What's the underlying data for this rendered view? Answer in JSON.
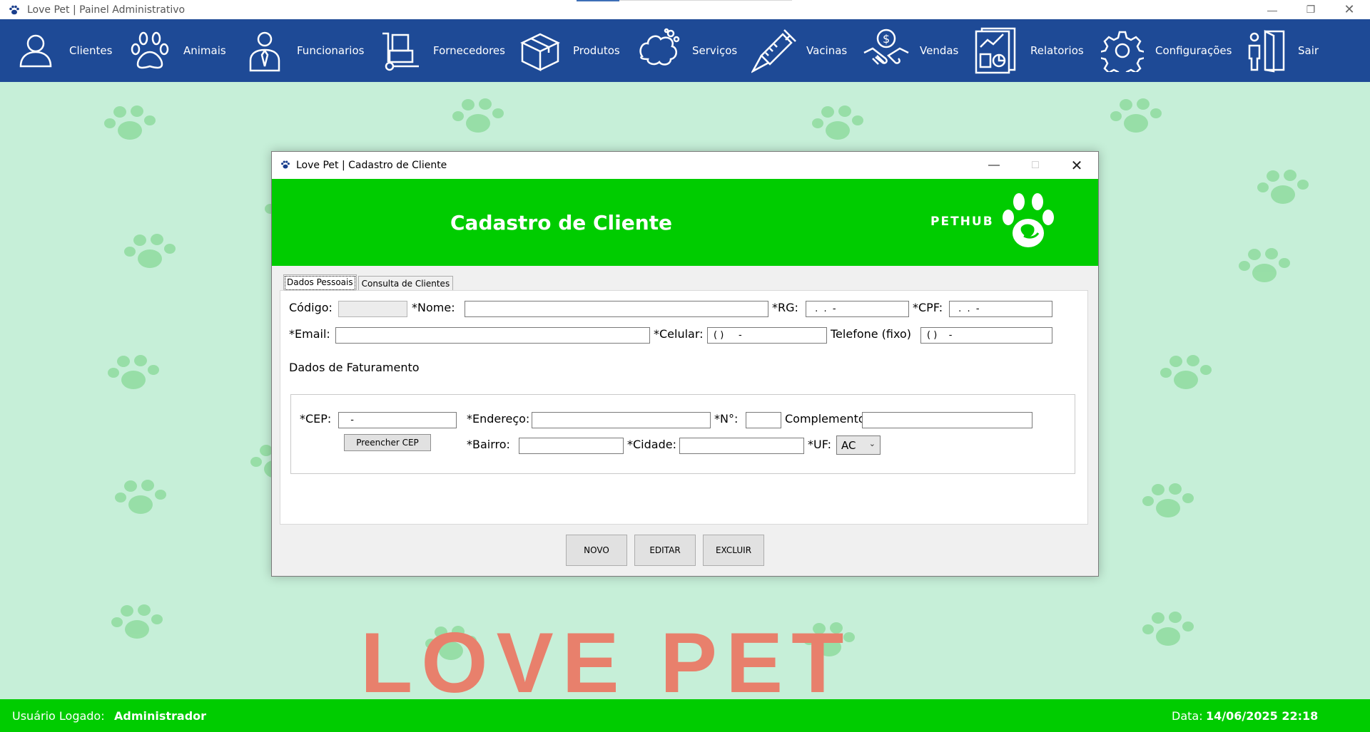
{
  "window": {
    "title": "Love Pet | Painel Administrativo"
  },
  "nav": {
    "items": [
      {
        "label": "Clientes",
        "icon": "user-icon"
      },
      {
        "label": "Animais",
        "icon": "paw-icon"
      },
      {
        "label": "Funcionarios",
        "icon": "employee-icon"
      },
      {
        "label": "Fornecedores",
        "icon": "hand-truck-icon"
      },
      {
        "label": "Produtos",
        "icon": "box-icon"
      },
      {
        "label": "Serviços",
        "icon": "bath-icon"
      },
      {
        "label": "Vacinas",
        "icon": "syringe-icon"
      },
      {
        "label": "Vendas",
        "icon": "handshake-icon"
      },
      {
        "label": "Relatorios",
        "icon": "report-icon"
      },
      {
        "label": "Configurações",
        "icon": "gear-icon"
      },
      {
        "label": "Sair",
        "icon": "exit-door-icon"
      }
    ]
  },
  "background": {
    "text": "LOVE PET"
  },
  "dialog": {
    "title": "Love Pet | Cadastro de Cliente",
    "header_title": "Cadastro de Cliente",
    "brand": "PETHUB",
    "tabs": [
      "Dados Pessoais",
      "Consulta de Clientes"
    ],
    "fields": {
      "codigo_label": "Código:",
      "nome_label": "*Nome:",
      "rg_label": "*RG:",
      "rg_mask": " .  .  -",
      "cpf_label": "*CPF:",
      "cpf_mask": " .  .  -",
      "email_label": "*Email:",
      "celular_label": "*Celular:",
      "celular_mask": "( )     -",
      "telefone_label": "Telefone (fixo)",
      "telefone_mask": "( )    -"
    },
    "faturamento": {
      "section_title": "Dados de Faturamento",
      "cep_label": "*CEP:",
      "cep_mask": "  -",
      "endereco_label": "*Endereço:",
      "numero_label": "*N°:",
      "complemento_label": "Complemento",
      "preencher_cep_button": "Preencher CEP",
      "bairro_label": "*Bairro:",
      "cidade_label": "*Cidade:",
      "uf_label": "*UF:",
      "uf_value": "AC"
    },
    "buttons": {
      "novo": "NOVO",
      "editar": "EDITAR",
      "excluir": "EXCLUIR"
    }
  },
  "status": {
    "user_label": "Usuário Logado:",
    "user_value": "Administrador",
    "date_label": "Data:",
    "date_value": "14/06/2025 22:18"
  },
  "colors": {
    "nav_bg": "#1e4a96",
    "accent_green": "#00cc00",
    "background": "#c6efd8",
    "paw": "#8fdc9f",
    "love_text": "#e8806c"
  }
}
